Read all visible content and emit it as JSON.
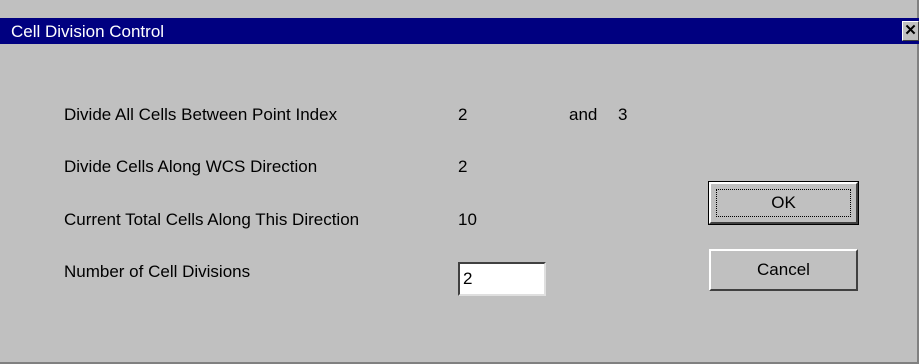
{
  "window": {
    "title": "Cell Division Control",
    "close_glyph": "✕"
  },
  "fields": {
    "point_index_label": "Divide All Cells Between Point Index",
    "point_index_from": "2",
    "and_label": "and",
    "point_index_to": "3",
    "direction_label": "Divide Cells Along WCS Direction",
    "direction_value": "2",
    "total_label": "Current Total Cells Along This Direction",
    "total_value": "10",
    "divisions_label": "Number of Cell Divisions",
    "divisions_value": "2"
  },
  "buttons": {
    "ok_label": "OK",
    "cancel_label": "Cancel"
  },
  "colors": {
    "titlebar": "#000080",
    "dialog_bg": "#c0c0c0"
  },
  "icons": {
    "close": "close-icon"
  }
}
